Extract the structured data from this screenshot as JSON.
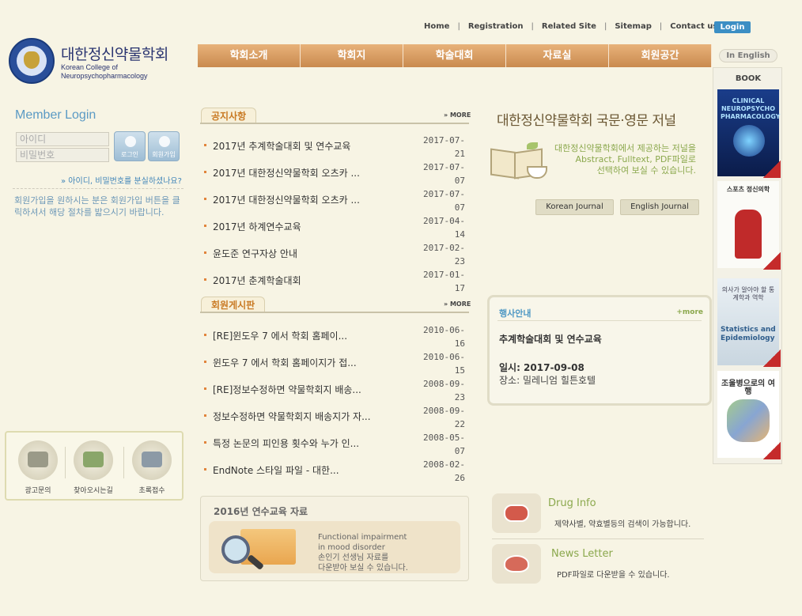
{
  "topnav": {
    "items": [
      "Home",
      "Registration",
      "Related Site",
      "Sitemap",
      "Contact us"
    ],
    "sep": "|",
    "login": "Login"
  },
  "logo": {
    "title": "대한정신약물학회",
    "sub1": "Korean College of",
    "sub2": "Neuropsychopharmacology"
  },
  "menu": {
    "items": [
      "학회소개",
      "학회지",
      "학술대회",
      "자료실",
      "회원공간"
    ],
    "english": "In English"
  },
  "member_login": {
    "title": "Member Login",
    "id_placeholder": "아이디",
    "pw_placeholder": "비밀번호",
    "login_btn": "로그인",
    "join_btn": "회원가입",
    "forgot": "» 아이디, 비밀번호를 분실하셨나요?",
    "note": "회원가입을 원하시는 분은 회원가입 버튼을 클릭하셔서 해당 절차를 밟으시기 바랍니다."
  },
  "quick": {
    "items": [
      "광고문의",
      "찾아오시는길",
      "초록접수"
    ]
  },
  "notices": {
    "title": "공지사항",
    "more": "» MORE",
    "items": [
      {
        "title": "2017년 추계학술대회 및 연수교육",
        "date1": "2017-07-",
        "date2": "21"
      },
      {
        "title": "2017년 대한정신약물학회 오츠카 ...",
        "date1": "2017-07-",
        "date2": "07"
      },
      {
        "title": "2017년 대한정신약물학회 오츠카 ...",
        "date1": "2017-07-",
        "date2": "07"
      },
      {
        "title": "2017년 하계연수교육",
        "date1": "2017-04-",
        "date2": "14"
      },
      {
        "title": "윤도준 연구자상 안내",
        "date1": "2017-02-",
        "date2": "23"
      },
      {
        "title": "2017년 춘계학술대회",
        "date1": "2017-01-",
        "date2": "17"
      }
    ]
  },
  "board": {
    "title": "회원게시판",
    "more": "» MORE",
    "items": [
      {
        "title": "[RE]윈도우 7 에서 학회 홈페이...",
        "date1": "2010-06-",
        "date2": "16"
      },
      {
        "title": "윈도우 7 에서 학회 홈페이지가 접...",
        "date1": "2010-06-",
        "date2": "15"
      },
      {
        "title": "[RE]정보수정하면 약물학회지 배송...",
        "date1": "2008-09-",
        "date2": "23"
      },
      {
        "title": "정보수정하면 약물학회지 배송지가 자...",
        "date1": "2008-09-",
        "date2": "22"
      },
      {
        "title": "특정 논문의 피인용 횟수와 누가 인...",
        "date1": "2008-05-",
        "date2": "07"
      },
      {
        "title": "EndNote 스타일 파일 - 대한...",
        "date1": "2008-02-",
        "date2": "26"
      }
    ]
  },
  "edu": {
    "title": "2016년 연수교육 자료",
    "line1": "Functional impairment",
    "line2": "in mood disorder",
    "line3": "손인기 선생님 자료를",
    "line4": "다운받아 보실 수 있습니다."
  },
  "journal": {
    "title": "대한정신약물학회 국문·영문 저널",
    "desc1": "대한정신약물학회에서 제공하는 저널을",
    "desc2": "Abstract, Fulltext, PDF파일로",
    "desc3": "선택하여 보실 수 있습니다.",
    "korean_btn": "Korean Journal",
    "english_btn": "English Journal"
  },
  "event": {
    "title": "행사안내",
    "more": "+more",
    "name": "추계학술대회 및 연수교육",
    "date": "일시: 2017-09-08",
    "place": "장소: 밀레니엄 힐튼호텔"
  },
  "drug": {
    "title": "Drug Info",
    "desc": "제약사별, 약효별등의 검색이 가능합니다."
  },
  "newsletter": {
    "title": "News Letter",
    "desc": "PDF파일로 다운받을 수 있습니다."
  },
  "books": {
    "label": "BOOK",
    "b1": "CLINICAL NEUROPSYCHO PHARMACOLOGY",
    "b2": "스포츠 정신의학",
    "b3a": "의사가 알아야 할 통계학과 역학",
    "b3b": "Statistics and Epidemiology",
    "b4": "조울병으로의 여행"
  },
  "colors": {
    "accent": "#3c8fc4",
    "menu": "#d49a5e",
    "green": "#8ba84d",
    "orange": "#c97a24"
  }
}
